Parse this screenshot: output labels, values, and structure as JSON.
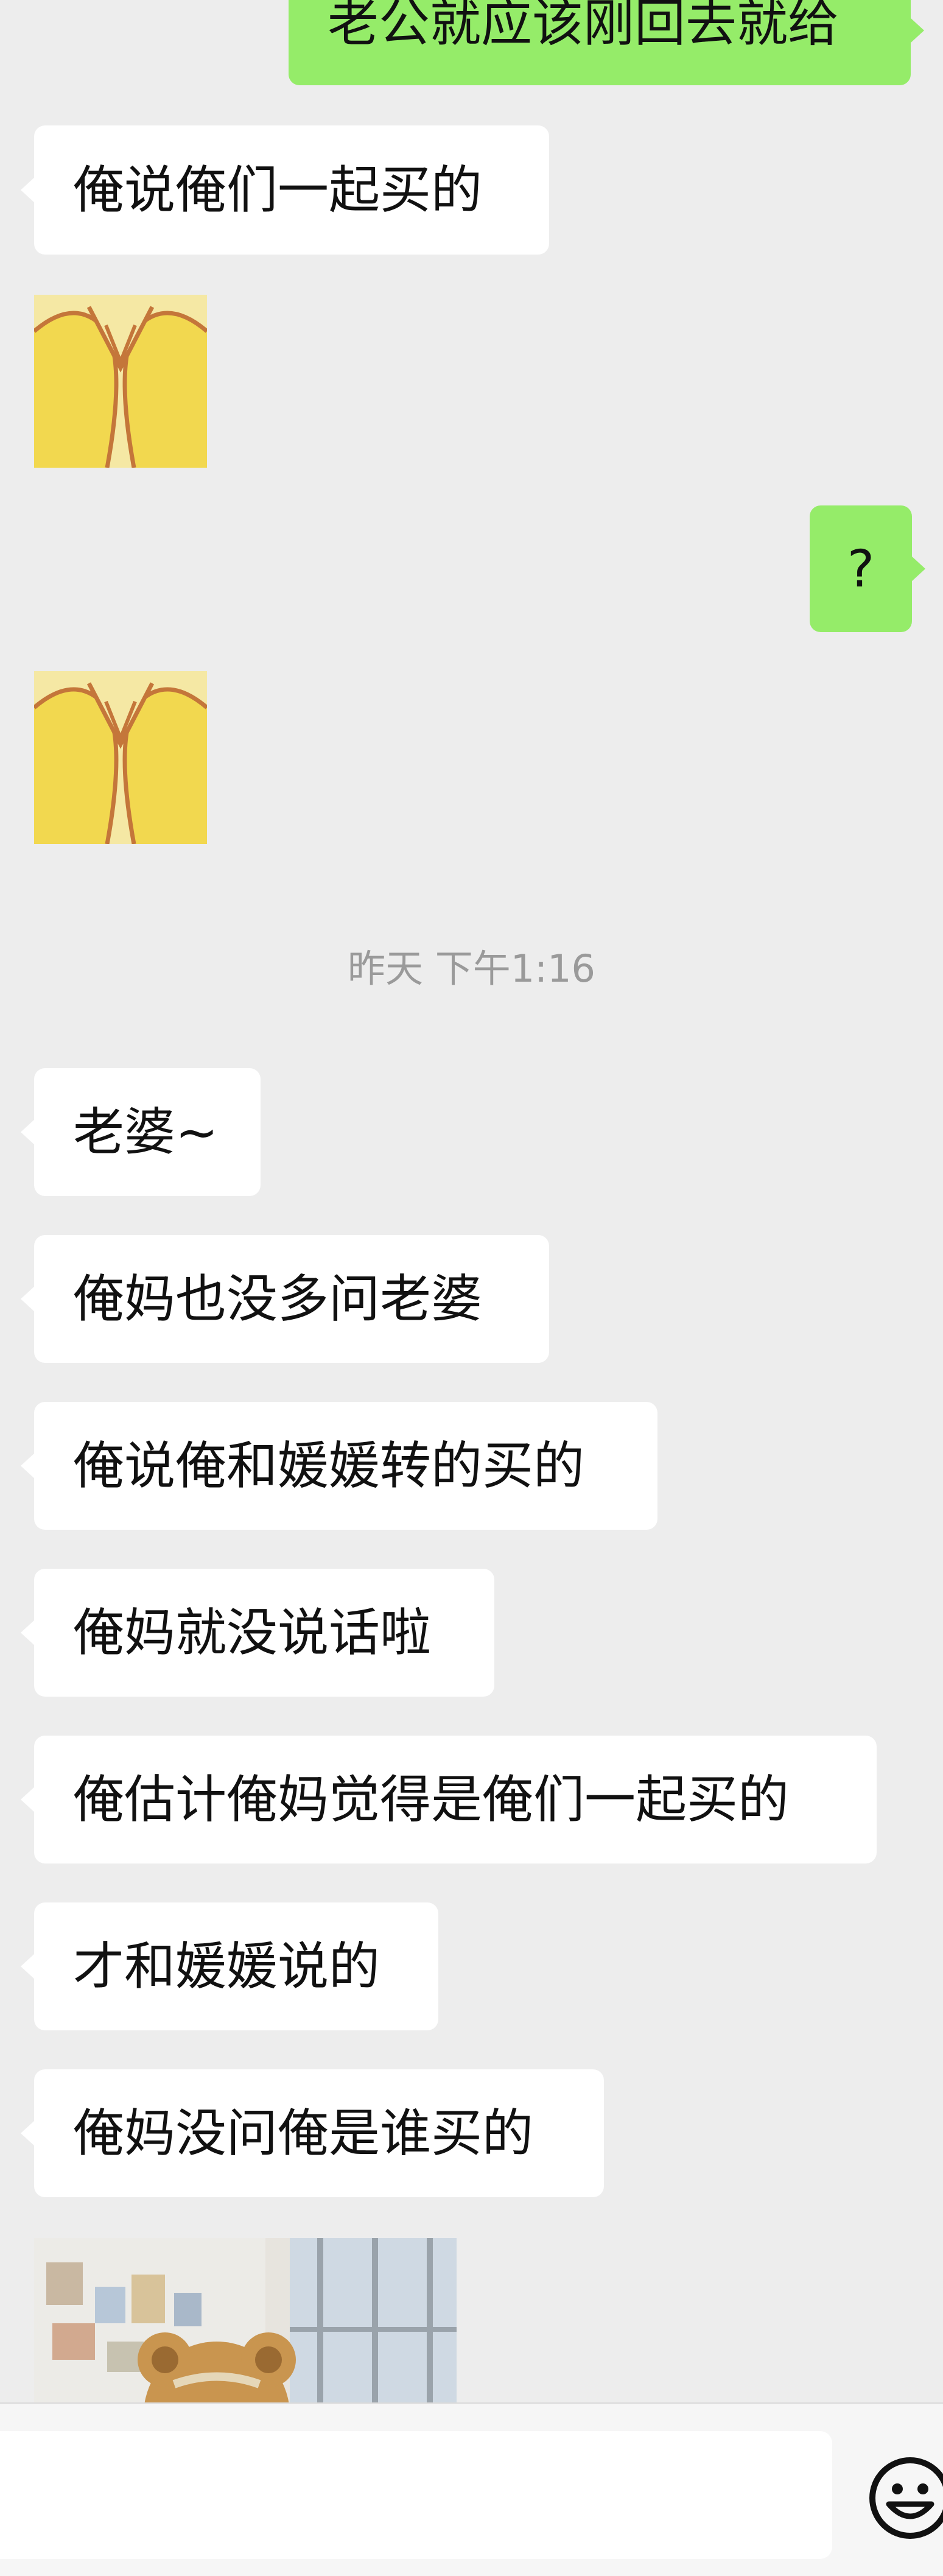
{
  "chat": {
    "messages": [
      {
        "side": "right",
        "type": "text",
        "text": "老公就应该刚回去就给"
      },
      {
        "side": "left",
        "type": "text",
        "text": "俺说俺们一起买的"
      },
      {
        "side": "left",
        "type": "sticker",
        "icon": "praying-hands-sticker"
      },
      {
        "side": "right",
        "type": "text",
        "text": "?"
      },
      {
        "side": "left",
        "type": "sticker",
        "icon": "praying-hands-sticker"
      },
      {
        "type": "time",
        "text": "昨天 下午1:16"
      },
      {
        "side": "left",
        "type": "text",
        "text": "老婆~"
      },
      {
        "side": "left",
        "type": "text",
        "text": "俺妈也没多问老婆"
      },
      {
        "side": "left",
        "type": "text",
        "text": "俺说俺和媛媛转的买的"
      },
      {
        "side": "left",
        "type": "text",
        "text": "俺妈就没说话啦"
      },
      {
        "side": "left",
        "type": "text",
        "text": "俺估计俺妈觉得是俺们一起买的"
      },
      {
        "side": "left",
        "type": "text",
        "text": "才和媛媛说的"
      },
      {
        "side": "left",
        "type": "text",
        "text": "俺妈没问俺是谁买的"
      },
      {
        "side": "left",
        "type": "image",
        "description_icon": "photo-teddy-bear"
      }
    ]
  },
  "input_bar": {
    "placeholder": "",
    "emoji_icon": "smiley-face-icon"
  },
  "colors": {
    "background": "#ededed",
    "bubble_self": "#95ec69",
    "bubble_other": "#ffffff",
    "timestamp": "#9a9a9a"
  }
}
